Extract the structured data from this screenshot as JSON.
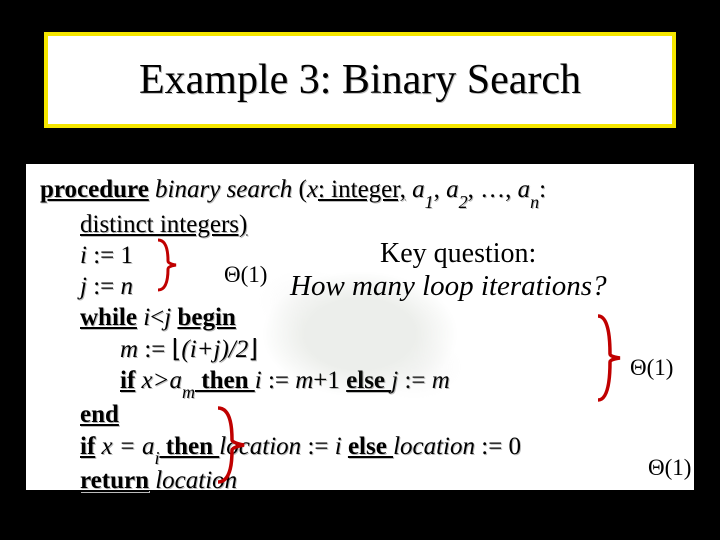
{
  "title": "Example 3: Binary Search",
  "proc": {
    "kw_procedure": "procedure",
    "name": "binary search",
    "sig_open": "(",
    "x": "x",
    "sig_xtype": ": integer,",
    "a1": "a",
    "a1sub": "1",
    "comma1": ", ",
    "a2": "a",
    "a2sub": "2",
    "comma2": ", …, ",
    "an": "a",
    "ansub": "n",
    "sig_rest": ":",
    "line2": "distinct integers)",
    "line3_i": "i",
    "line3_rest": " := 1",
    "line4_j": "j",
    "line4_rest": " := ",
    "line4_n": "n",
    "kw_while": "while",
    "while_cond_i": " i",
    "while_lt": "<",
    "while_j": "j ",
    "kw_begin": "begin",
    "line6_m": "m",
    "line6_assign": " := ",
    "line6_floor_l": "⌊",
    "line6_expr": "(i+j)/2",
    "line6_floor_r": "⌋",
    "kw_if1": "if",
    "if1_cond": " x>a",
    "if1_sub": "m",
    "kw_then1": " then ",
    "then1_i": "i",
    "then1_assign": " := ",
    "then1_val": "m",
    "then1_plus": "+1 ",
    "kw_else1": "else ",
    "else1_j": "j",
    "else1_assign": " := ",
    "else1_val": "m",
    "kw_end": "end",
    "kw_if2": "if",
    "if2_x": " x = a",
    "if2_sub": "i",
    "kw_then2": " then ",
    "loc1": "location",
    "loc1_assign": " := ",
    "loc1_val": "i ",
    "kw_else2": "else ",
    "loc2": "location",
    "loc2_assign": " := 0",
    "kw_return": "return",
    "ret_var": " location"
  },
  "annot": {
    "theta1": "Θ(1)",
    "theta2": "Θ(1)",
    "theta3": "Θ(1)",
    "kq_line1": "Key question:",
    "kq_line2": "How many loop iterations?"
  }
}
